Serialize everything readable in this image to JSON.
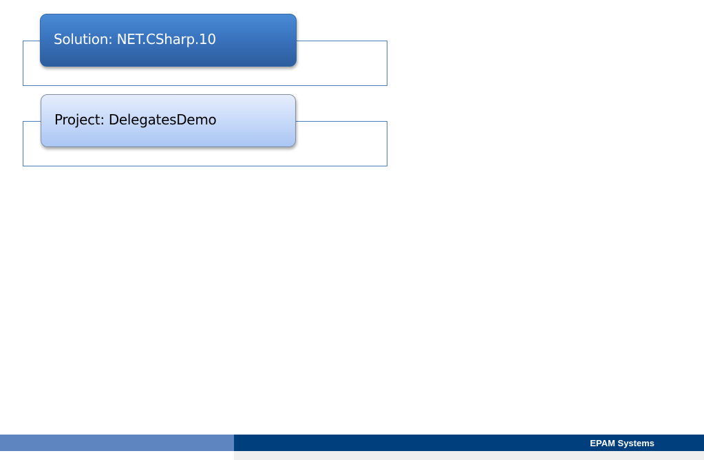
{
  "nodes": {
    "solution": {
      "label": "Solution: NET.CSharp.10"
    },
    "project": {
      "label": "Project: DelegatesDemo"
    }
  },
  "footer": {
    "company": "EPAM Systems"
  },
  "colors": {
    "solution_fill": "#3a74bf",
    "project_fill": "#c8daf9",
    "frame_border": "#4a7ebb",
    "footer_left": "#5f85c1",
    "footer_right": "#003f7d"
  }
}
